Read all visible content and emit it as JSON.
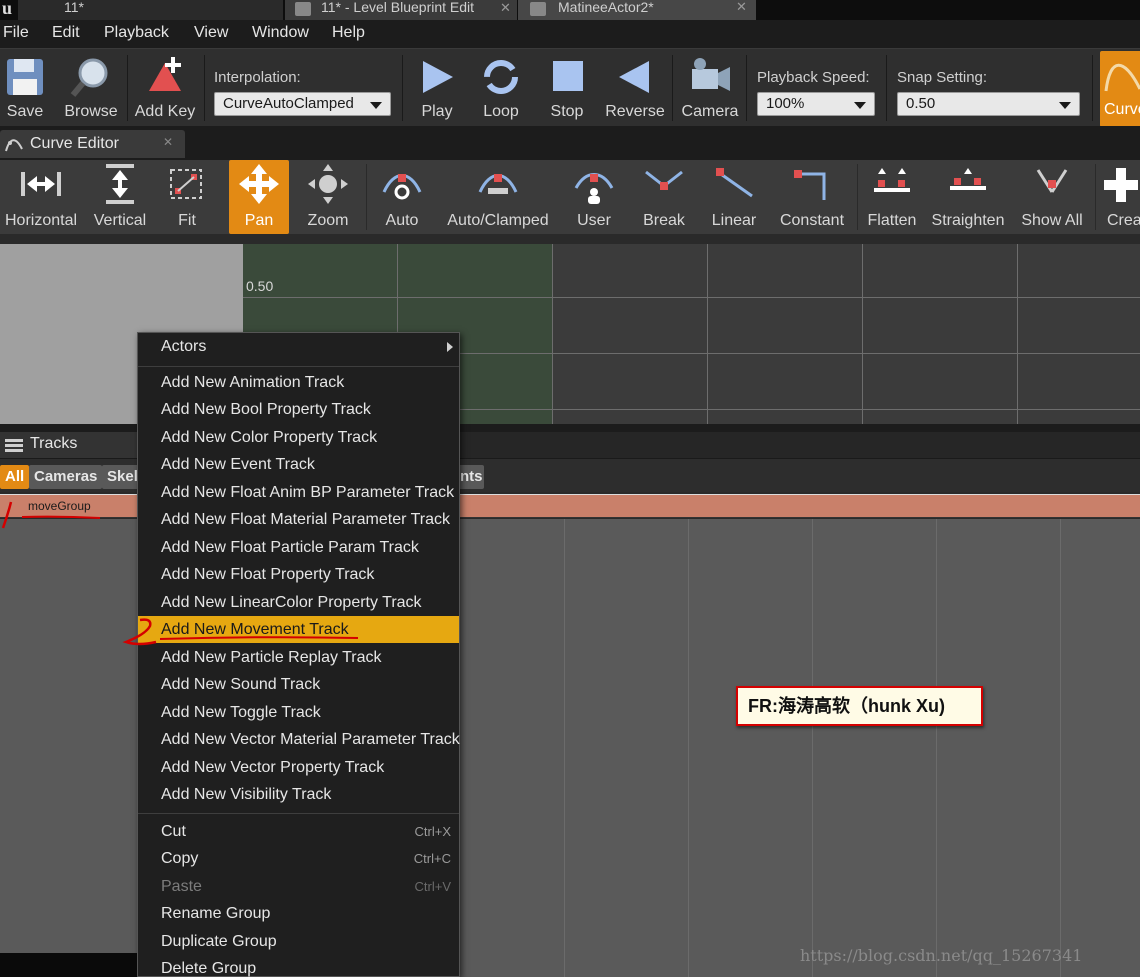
{
  "titlebar": {
    "tab1": "11*",
    "tab2": "11* - Level Blueprint Edit",
    "tab3": "MatineeActor2*"
  },
  "menu": [
    "File",
    "Edit",
    "Playback",
    "View",
    "Window",
    "Help"
  ],
  "toolbar": {
    "save": "Save",
    "browse": "Browse",
    "add_key": "Add Key",
    "interpolation_label": "Interpolation:",
    "interpolation_value": "CurveAutoClamped",
    "play": "Play",
    "loop": "Loop",
    "stop": "Stop",
    "reverse": "Reverse",
    "camera": "Camera",
    "playback_speed_label": "Playback Speed:",
    "playback_speed_value": "100%",
    "snap_setting_label": "Snap Setting:",
    "snap_setting_value": "0.50",
    "curve": "Curve"
  },
  "curve_editor": {
    "tab_label": "Curve Editor",
    "buttons": [
      "Horizontal",
      "Vertical",
      "Fit",
      "Pan",
      "Zoom",
      "Auto",
      "Auto/Clamped",
      "User",
      "Break",
      "Linear",
      "Constant",
      "Flatten",
      "Straighten",
      "Show All",
      "Crea"
    ],
    "active_button": "Pan",
    "graph_value_label": "0.50"
  },
  "tracks": {
    "tab_label": "Tracks",
    "filters": [
      "All",
      "Cameras",
      "Skel"
    ],
    "filter_tail": "nts",
    "group_name": "moveGroup"
  },
  "context_menu": {
    "submenu": "Actors",
    "items": [
      "Add New Animation Track",
      "Add New Bool Property Track",
      "Add New Color Property Track",
      "Add New Event Track",
      "Add New Float Anim BP Parameter Track",
      "Add New Float Material Parameter Track",
      "Add New Float Particle Param Track",
      "Add New Float Property Track",
      "Add New LinearColor Property Track",
      "Add New Movement Track",
      "Add New Particle Replay Track",
      "Add New Sound Track",
      "Add New Toggle Track",
      "Add New Vector Material Parameter Track",
      "Add New Vector Property Track",
      "Add New Visibility Track"
    ],
    "highlighted": "Add New Movement Track",
    "edit_items": [
      {
        "label": "Cut",
        "shortcut": "Ctrl+X",
        "disabled": false
      },
      {
        "label": "Copy",
        "shortcut": "Ctrl+C",
        "disabled": false
      },
      {
        "label": "Paste",
        "shortcut": "Ctrl+V",
        "disabled": true
      }
    ],
    "group_items": [
      "Rename Group",
      "Duplicate Group",
      "Delete Group"
    ]
  },
  "watermark": {
    "box_text": "FR:海涛高软（hunk Xu)",
    "url": "https://blog.csdn.net/qq_15267341"
  },
  "colors": {
    "accent_orange": "#e38a14",
    "menu_highlight": "#e6a811",
    "group_row": "#c9806a",
    "annotation_red": "#d40000"
  }
}
